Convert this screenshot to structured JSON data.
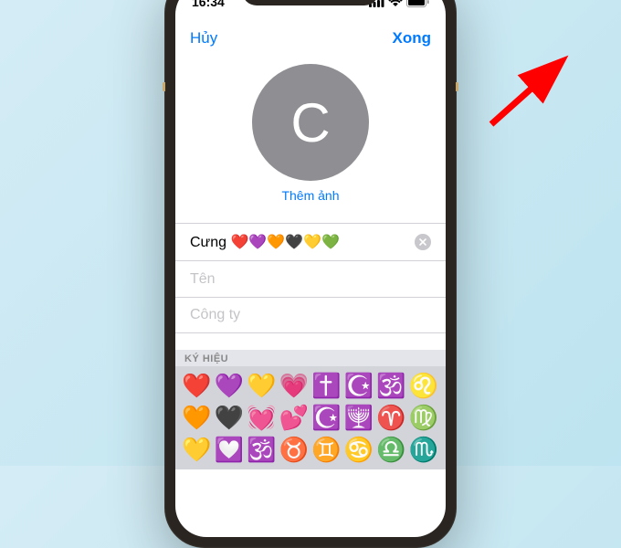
{
  "statusbar": {
    "time": "16:34"
  },
  "nav": {
    "cancel": "Hủy",
    "done": "Xong"
  },
  "avatar": {
    "initial": "C",
    "add_photo": "Thêm ảnh"
  },
  "fields": {
    "first_name_value": "Cưng ❤️💜🧡🖤💛💚",
    "last_name_placeholder": "Tên",
    "company_placeholder": "Công ty"
  },
  "keyboard": {
    "section_label": "KÝ HIỆU",
    "rows": [
      [
        "❤️",
        "💜",
        "💛",
        "💗",
        "✝️",
        "☪️",
        "🕉️",
        "♌"
      ],
      [
        "🧡",
        "🖤",
        "💓",
        "💕",
        "☪️",
        "🕎",
        "♈",
        "♍"
      ],
      [
        "💛",
        "💟",
        "🕉️",
        "♉",
        "♊",
        "♋",
        "♎",
        "♏"
      ]
    ]
  },
  "colors": {
    "accent": "#007aff",
    "arrow": "#ff0000"
  }
}
